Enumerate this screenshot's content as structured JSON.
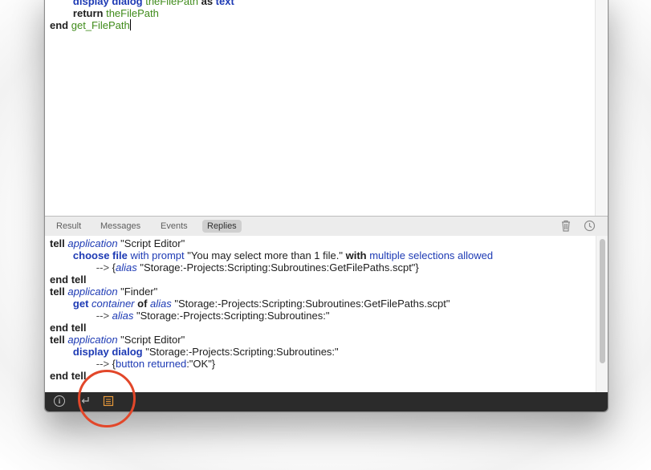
{
  "editor": {
    "lines": [
      {
        "indent": "        ",
        "parts": [
          [
            "cmd",
            "display dialog"
          ],
          [
            "var",
            " theFilePath "
          ],
          [
            "kw",
            "as"
          ],
          [
            "cmd",
            " text"
          ]
        ]
      },
      {
        "indent": "        ",
        "parts": [
          [
            "kw",
            "return "
          ],
          [
            "var",
            "theFilePath"
          ]
        ]
      },
      {
        "indent": "",
        "parts": [
          [
            "kw",
            "end "
          ],
          [
            "var",
            "get_FilePath"
          ]
        ]
      }
    ]
  },
  "tabs": [
    {
      "label": "Result"
    },
    {
      "label": "Messages"
    },
    {
      "label": "Events"
    },
    {
      "label": "Replies",
      "active": true
    }
  ],
  "toolbar_icons": {
    "trash": "trash-icon",
    "history": "clock-icon"
  },
  "replies": [
    [
      [
        "kw",
        "tell "
      ],
      [
        "cls",
        "application"
      ],
      [
        "str",
        " \"Script Editor\""
      ]
    ],
    [
      [
        "str",
        "        "
      ],
      [
        "cmd",
        "choose file"
      ],
      [
        "prop",
        " with prompt"
      ],
      [
        "str",
        " \"You may select more than 1 file.\" "
      ],
      [
        "kw",
        "with"
      ],
      [
        "prop",
        " multiple selections allowed"
      ]
    ],
    [
      [
        "arrow",
        "                --> "
      ],
      [
        "str",
        "{"
      ],
      [
        "cls",
        "alias"
      ],
      [
        "str",
        " \"Storage:-Projects:Scripting:Subroutines:GetFilePaths.scpt\"}"
      ]
    ],
    [
      [
        "kw",
        "end tell"
      ]
    ],
    [
      [
        "kw",
        "tell "
      ],
      [
        "cls",
        "application"
      ],
      [
        "str",
        " \"Finder\""
      ]
    ],
    [
      [
        "str",
        "        "
      ],
      [
        "cmd",
        "get "
      ],
      [
        "cls",
        "container"
      ],
      [
        "kw",
        " of "
      ],
      [
        "cls",
        "alias"
      ],
      [
        "str",
        " \"Storage:-Projects:Scripting:Subroutines:GetFilePaths.scpt\""
      ]
    ],
    [
      [
        "arrow",
        "                --> "
      ],
      [
        "cls",
        "alias"
      ],
      [
        "str",
        " \"Storage:-Projects:Scripting:Subroutines:\""
      ]
    ],
    [
      [
        "kw",
        "end tell"
      ]
    ],
    [
      [
        "kw",
        "tell "
      ],
      [
        "cls",
        "application"
      ],
      [
        "str",
        " \"Script Editor\""
      ]
    ],
    [
      [
        "str",
        "        "
      ],
      [
        "cmd",
        "display dialog"
      ],
      [
        "str",
        " \"Storage:-Projects:Scripting:Subroutines:\""
      ]
    ],
    [
      [
        "arrow",
        "                --> "
      ],
      [
        "str",
        "{"
      ],
      [
        "prop",
        "button returned"
      ],
      [
        "str",
        ":\"OK\"}"
      ]
    ],
    [
      [
        "kw",
        "end tell"
      ]
    ]
  ],
  "statusbar": {
    "icons": [
      "info-icon",
      "return-icon",
      "log-list-icon"
    ]
  }
}
